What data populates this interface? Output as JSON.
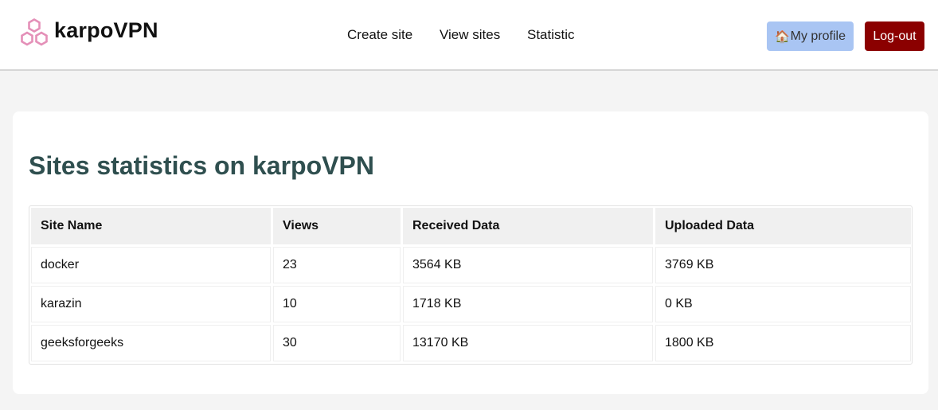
{
  "header": {
    "brand": "karpoVPN",
    "logo_icon": "hexagon-cluster-icon",
    "brand_color": "#e490b8",
    "nav": [
      {
        "label": "Create site"
      },
      {
        "label": "View sites"
      },
      {
        "label": "Statistic"
      }
    ],
    "profile_button": {
      "icon": "🏠",
      "label": "My profile",
      "color": "#a9c5f3"
    },
    "logout_button": {
      "label": "Log-out",
      "color": "#8b0000"
    }
  },
  "main": {
    "title": "Sites statistics on karpoVPN",
    "title_color": "#2f4f4f",
    "table": {
      "columns": [
        "Site Name",
        "Views",
        "Received Data",
        "Uploaded Data"
      ],
      "rows": [
        [
          "docker",
          "23",
          "3564 KB",
          "3769 KB"
        ],
        [
          "karazin",
          "10",
          "1718 KB",
          "0 KB"
        ],
        [
          "geeksforgeeks",
          "30",
          "13170 KB",
          "1800 KB"
        ]
      ]
    }
  }
}
